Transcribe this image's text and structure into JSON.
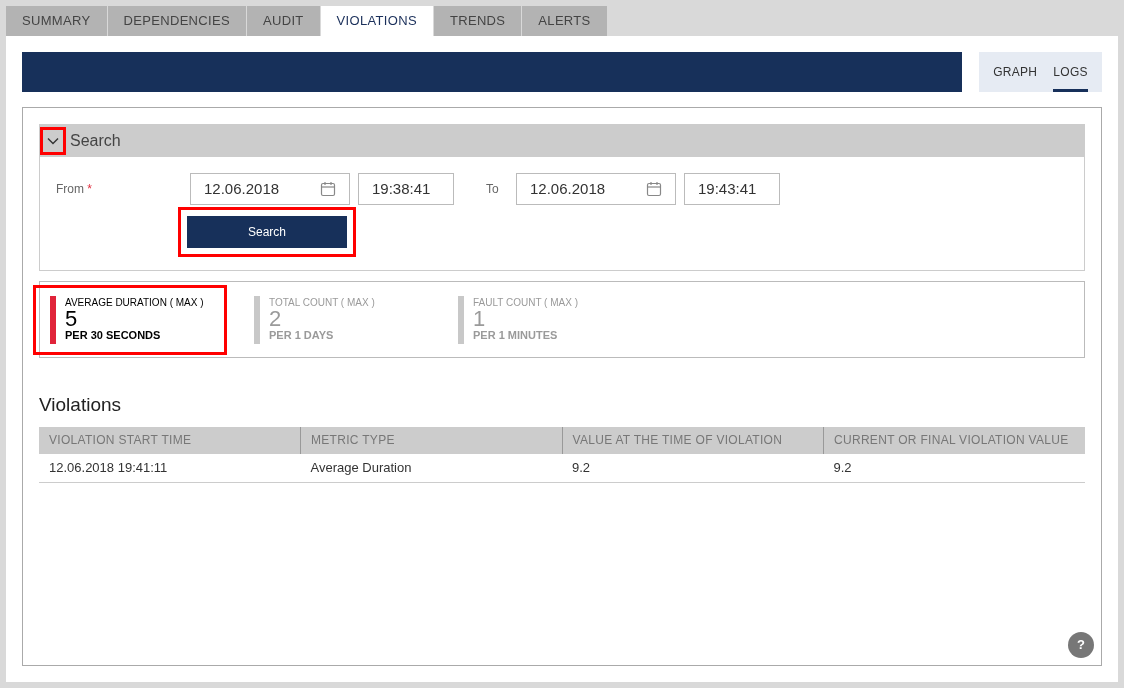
{
  "tabs": [
    {
      "label": "SUMMARY",
      "selected": false
    },
    {
      "label": "DEPENDENCIES",
      "selected": false
    },
    {
      "label": "AUDIT",
      "selected": false
    },
    {
      "label": "VIOLATIONS",
      "selected": true
    },
    {
      "label": "TRENDS",
      "selected": false
    },
    {
      "label": "ALERTS",
      "selected": false
    }
  ],
  "view_toggle": [
    {
      "label": "GRAPH",
      "selected": false
    },
    {
      "label": "LOGS",
      "selected": true
    }
  ],
  "search": {
    "title": "Search",
    "expanded": true,
    "toggle_highlighted": true,
    "from_label": "From",
    "required_mark": "*",
    "from_date": "12.06.2018",
    "from_time": "19:38:41",
    "to_label": "To",
    "to_date": "12.06.2018",
    "to_time": "19:43:41",
    "button": "Search",
    "button_highlighted": true
  },
  "metrics": [
    {
      "title": "AVERAGE DURATION ( MAX )",
      "value": "5",
      "period": "PER 30 SECONDS",
      "selected": true,
      "highlighted": true
    },
    {
      "title": "TOTAL COUNT ( MAX )",
      "value": "2",
      "period": "PER 1 DAYS",
      "selected": false,
      "highlighted": false
    },
    {
      "title": "FAULT COUNT ( MAX )",
      "value": "1",
      "period": "PER 1 MINUTES",
      "selected": false,
      "highlighted": false
    }
  ],
  "violations": {
    "title": "Violations",
    "columns": [
      "VIOLATION START TIME",
      "METRIC TYPE",
      "VALUE AT THE TIME OF VIOLATION",
      "CURRENT OR FINAL VIOLATION VALUE"
    ],
    "rows": [
      [
        "12.06.2018 19:41:11",
        "Average Duration",
        "9.2",
        "9.2"
      ]
    ]
  },
  "help": "?"
}
